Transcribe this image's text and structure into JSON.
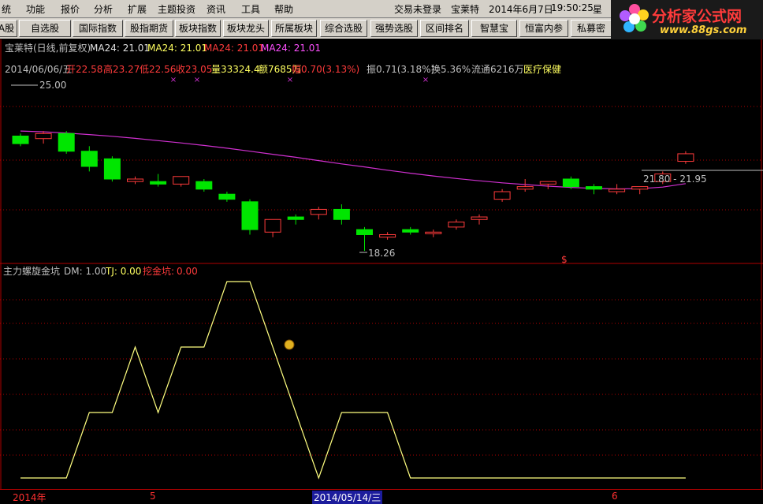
{
  "menu": {
    "items": [
      "统",
      "功能",
      "报价",
      "分析",
      "扩展",
      "主题投资",
      "资讯",
      "工具",
      "帮助"
    ],
    "login_status": "交易未登录",
    "stock_name": "宝莱特",
    "date": "2014年6月7日",
    "time": "19:50:25",
    "weekday_prefix": "星"
  },
  "logo": {
    "brand": "分析家公式网",
    "url": "www.88gs.com"
  },
  "toolbar": {
    "buttons": [
      "A股",
      "自选股",
      "国际指数",
      "股指期货",
      "板块指数",
      "板块龙头",
      "所属板块",
      "综合选股",
      "强势选股",
      "区间排名",
      "智慧宝",
      "恒富内参",
      "私募密"
    ]
  },
  "main_chart": {
    "title_stock": "宝莱特(日线,前复权)",
    "ma_labels": [
      "MA24: 21.01",
      "MA24: 21.01",
      "MA24: 21.01",
      "MA24: 21.01"
    ],
    "info": {
      "date": "2014/06/06/五",
      "open": "开22.58",
      "high": "高23.27",
      "low": "低22.56",
      "close": "收23.05",
      "volume": "量33324.4",
      "amount": "额7685万",
      "change": "幅0.70(3.13%)",
      "amplitude": "振0.71(3.18%)",
      "turnover": "换5.36%",
      "float": "流通6216万",
      "sector": "医疗保健"
    },
    "high_label": "25.00",
    "low_label": "18.26",
    "range_label": "21.80 - 21.95",
    "dollar_mark": "$",
    "colors": {
      "up": "#ff3b3b",
      "down": "#00e600",
      "ma": "#d030d0",
      "grid": "#b00000"
    }
  },
  "indicator": {
    "name": "主力螺旋金坑",
    "dm": "DM: 1.00",
    "tj": "TJ: 0.00",
    "pit_label": "挖金坑:",
    "pit_value": "0.00",
    "color": "#ffff80"
  },
  "time_axis": {
    "labels": [
      "2014年",
      "5",
      "6"
    ],
    "highlight": "2014/05/14/三"
  },
  "chart_data": {
    "type": "candlestick",
    "candles": [
      {
        "o": 22.8,
        "h": 22.9,
        "l": 22.4,
        "c": 22.5,
        "dir": "down"
      },
      {
        "o": 22.7,
        "h": 23.0,
        "l": 22.5,
        "c": 22.9,
        "dir": "up"
      },
      {
        "o": 22.9,
        "h": 23.0,
        "l": 22.1,
        "c": 22.2,
        "dir": "down"
      },
      {
        "o": 22.2,
        "h": 22.4,
        "l": 21.4,
        "c": 21.6,
        "dir": "down"
      },
      {
        "o": 21.9,
        "h": 22.0,
        "l": 21.0,
        "c": 21.1,
        "dir": "down"
      },
      {
        "o": 21.0,
        "h": 21.2,
        "l": 20.9,
        "c": 21.1,
        "dir": "up"
      },
      {
        "o": 21.0,
        "h": 21.3,
        "l": 20.8,
        "c": 20.9,
        "dir": "down"
      },
      {
        "o": 20.9,
        "h": 21.1,
        "l": 20.8,
        "c": 21.2,
        "dir": "up"
      },
      {
        "o": 21.0,
        "h": 21.1,
        "l": 20.6,
        "c": 20.7,
        "dir": "down"
      },
      {
        "o": 20.5,
        "h": 20.6,
        "l": 20.2,
        "c": 20.3,
        "dir": "down"
      },
      {
        "o": 20.2,
        "h": 20.3,
        "l": 18.9,
        "c": 19.1,
        "dir": "down"
      },
      {
        "o": 19.0,
        "h": 19.2,
        "l": 18.8,
        "c": 19.5,
        "dir": "up"
      },
      {
        "o": 19.5,
        "h": 19.7,
        "l": 19.3,
        "c": 19.6,
        "dir": "down"
      },
      {
        "o": 19.7,
        "h": 20.0,
        "l": 19.5,
        "c": 19.9,
        "dir": "up"
      },
      {
        "o": 19.9,
        "h": 20.1,
        "l": 19.3,
        "c": 19.5,
        "dir": "down"
      },
      {
        "o": 19.1,
        "h": 19.2,
        "l": 18.26,
        "c": 18.9,
        "dir": "down"
      },
      {
        "o": 18.9,
        "h": 19.0,
        "l": 18.7,
        "c": 18.8,
        "dir": "up"
      },
      {
        "o": 19.0,
        "h": 19.2,
        "l": 18.9,
        "c": 19.1,
        "dir": "down"
      },
      {
        "o": 19.0,
        "h": 19.1,
        "l": 18.8,
        "c": 19.0,
        "dir": "up"
      },
      {
        "o": 19.2,
        "h": 19.5,
        "l": 19.1,
        "c": 19.4,
        "dir": "up"
      },
      {
        "o": 19.5,
        "h": 19.7,
        "l": 19.3,
        "c": 19.6,
        "dir": "up"
      },
      {
        "o": 20.3,
        "h": 20.7,
        "l": 20.2,
        "c": 20.6,
        "dir": "up"
      },
      {
        "o": 20.7,
        "h": 21.1,
        "l": 20.6,
        "c": 20.8,
        "dir": "up"
      },
      {
        "o": 20.9,
        "h": 21.0,
        "l": 20.7,
        "c": 21.0,
        "dir": "up"
      },
      {
        "o": 21.1,
        "h": 21.2,
        "l": 20.7,
        "c": 20.8,
        "dir": "down"
      },
      {
        "o": 20.8,
        "h": 20.9,
        "l": 20.5,
        "c": 20.7,
        "dir": "down"
      },
      {
        "o": 20.6,
        "h": 20.9,
        "l": 20.5,
        "c": 20.7,
        "dir": "up"
      },
      {
        "o": 20.7,
        "h": 20.8,
        "l": 20.5,
        "c": 20.8,
        "dir": "up"
      },
      {
        "o": 21.0,
        "h": 21.4,
        "l": 20.9,
        "c": 21.3,
        "dir": "up"
      },
      {
        "o": 21.8,
        "h": 22.2,
        "l": 21.7,
        "c": 22.1,
        "dir": "up"
      }
    ],
    "ma24": [
      23.0,
      22.97,
      22.92,
      22.86,
      22.79,
      22.71,
      22.62,
      22.53,
      22.43,
      22.32,
      22.2,
      22.08,
      21.96,
      21.83,
      21.7,
      21.58,
      21.45,
      21.33,
      21.22,
      21.12,
      21.03,
      20.95,
      20.88,
      20.82,
      20.77,
      20.73,
      20.71,
      20.72,
      20.78,
      20.92
    ],
    "indicator_values": [
      0,
      0,
      0,
      1,
      1,
      2,
      1,
      2,
      2,
      3,
      3,
      2,
      1,
      0,
      1,
      1,
      1,
      0,
      0,
      0,
      0,
      0,
      0,
      0,
      0,
      0,
      0,
      0,
      0,
      0
    ]
  }
}
